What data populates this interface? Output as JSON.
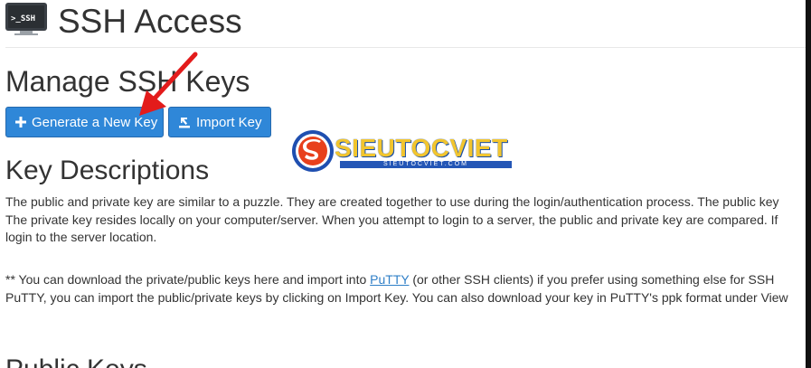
{
  "header": {
    "icon_label": ">_SSH",
    "title": "SSH Access"
  },
  "manage": {
    "heading": "Manage SSH Keys",
    "generate_label": "Generate a New Key",
    "import_label": "Import Key"
  },
  "watermark": {
    "name": "SIEUTOCVIET",
    "sub": "SIEUTOCVIET.COM"
  },
  "descriptions": {
    "heading": "Key Descriptions",
    "p1_line1": "The public and private key are similar to a puzzle. They are created together to use during the login/authentication process. The public key",
    "p1_line2": "The private key resides locally on your computer/server. When you attempt to login to a server, the public and private key are compared. If",
    "p1_line3": "login to the server location.",
    "p2_line1_pre": "** You can download the private/public keys here and import into ",
    "p2_link": "PuTTY",
    "p2_line1_post": " (or other SSH clients) if you prefer using something else for SSH",
    "p2_line2": "PuTTY, you can import the public/private keys by clicking on Import Key. You can also download your key in PuTTY's ppk format under View"
  },
  "public_keys": {
    "heading": "Public Keys"
  },
  "colors": {
    "button_bg": "#2f87d8",
    "arrow": "#e31b1b",
    "link": "#2f7fc7"
  }
}
